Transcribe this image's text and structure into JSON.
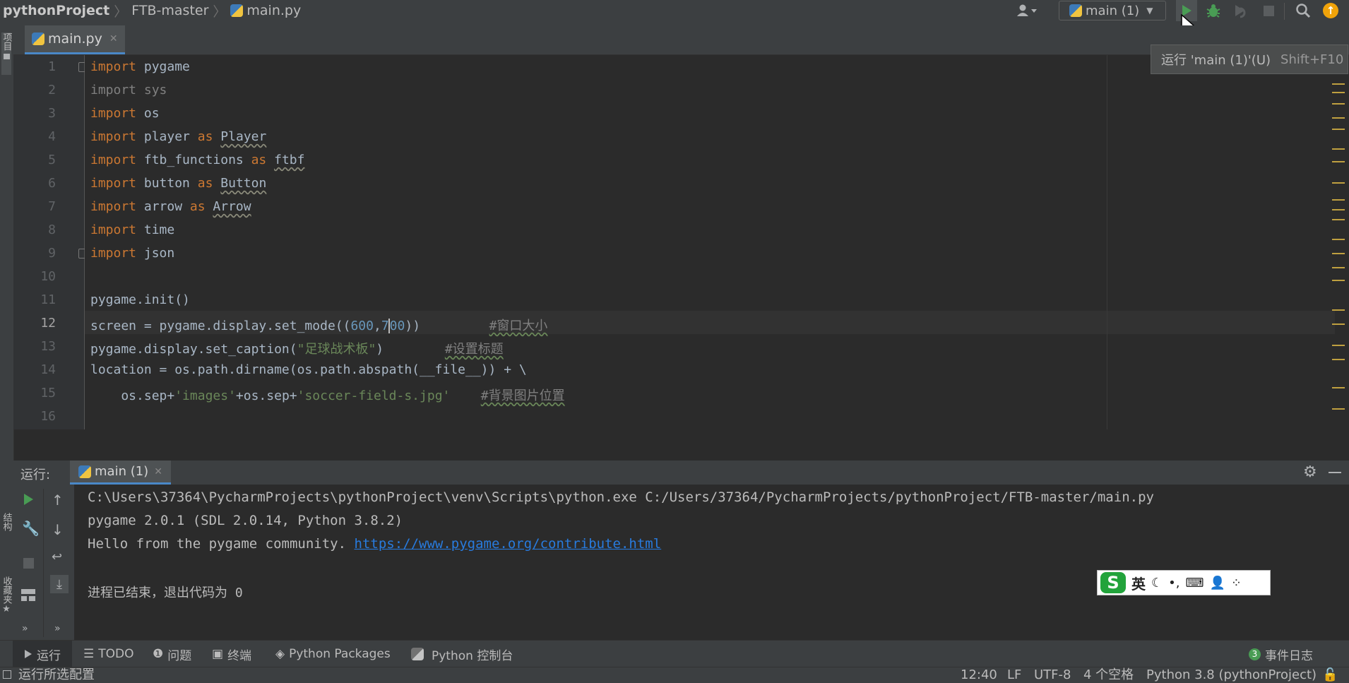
{
  "navbar": {
    "project": "pythonProject",
    "folder": "FTB-master",
    "file": "main.py",
    "run_config": "main (1)"
  },
  "tooltip": {
    "text": "运行 'main (1)'(U)",
    "shortcut": "Shift+F10"
  },
  "editor": {
    "tab_label": "main.py",
    "current_line": 12
  },
  "run_panel": {
    "label": "运行:",
    "tab": "main (1)",
    "lines": [
      "C:\\Users\\37364\\PycharmProjects\\pythonProject\\venv\\Scripts\\python.exe C:/Users/37364/PycharmProjects/pythonProject/FTB-master/main.py",
      "pygame 2.0.1 (SDL 2.0.14, Python 3.8.2)",
      "Hello from the pygame community. ",
      "进程已结束，退出代码为 0"
    ],
    "link": "https://www.pygame.org/contribute.html"
  },
  "ime": {
    "lang": "英"
  },
  "left_stripe": {
    "project": "项目",
    "structure": "结构",
    "favorites": "收藏夹"
  },
  "bottom_tabs": {
    "run": "运行",
    "todo": "TODO",
    "problems": "问题",
    "terminal": "终端",
    "packages": "Python Packages",
    "console": "Python 控制台",
    "event_log": "事件日志",
    "event_count": "3"
  },
  "status": {
    "message": "运行所选配置",
    "position": "12:40",
    "line_sep": "LF",
    "encoding": "UTF-8",
    "indent": "4 个空格",
    "interpreter": "Python 3.8 (pythonProject)"
  },
  "colors": {
    "run_green": "#499c54",
    "debug_green": "#499c54",
    "update_orange": "#f0a30a",
    "link_blue": "#287bde",
    "keyword": "#cc7832",
    "string": "#6a8759",
    "number": "#6897bb"
  }
}
